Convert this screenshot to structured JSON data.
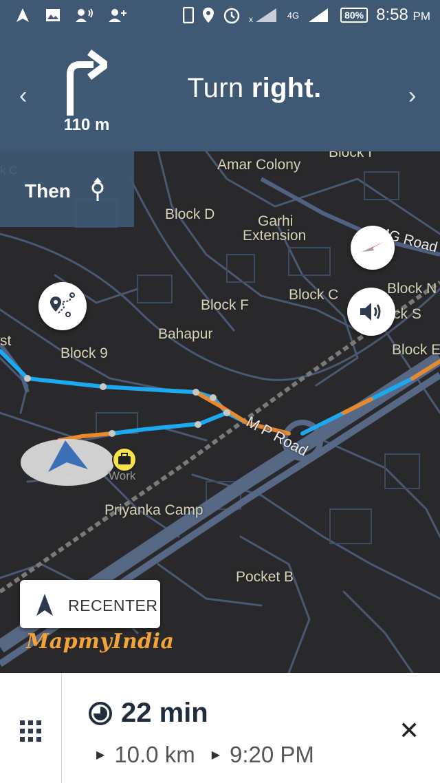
{
  "status_bar": {
    "network": "4G",
    "battery": "80%",
    "time": "8:58",
    "ampm": "PM"
  },
  "navigation": {
    "instruction_action": "Turn",
    "instruction_direction": "right.",
    "distance": "110 m",
    "then_label": "Then"
  },
  "map": {
    "labels": {
      "block_top": "Block I",
      "amar_colony": "Amar Colony",
      "block_d": "Block D",
      "garhi_1": "Garhi",
      "garhi_2": "Extension",
      "mg_road": "MG Road",
      "block_n": "Block N",
      "block_s": "ck S",
      "block_c": "Block C",
      "block_f": "Block F",
      "bahapur": "Bahapur",
      "block_9": "Block 9",
      "block_e": "Block E",
      "st": "st",
      "kc": "k C",
      "mp_road": "M P Road",
      "work": "Work",
      "priyanka_camp": "Priyanka Camp",
      "pocket_b": "Pocket B"
    },
    "recenter_label": "RECENTER",
    "brand": "MapmyIndia",
    "route_color": "#1da9f0",
    "traffic_color": "#e8892e"
  },
  "trip": {
    "duration": "22 min",
    "distance": "10.0 km",
    "arrival": "9:20 PM"
  }
}
